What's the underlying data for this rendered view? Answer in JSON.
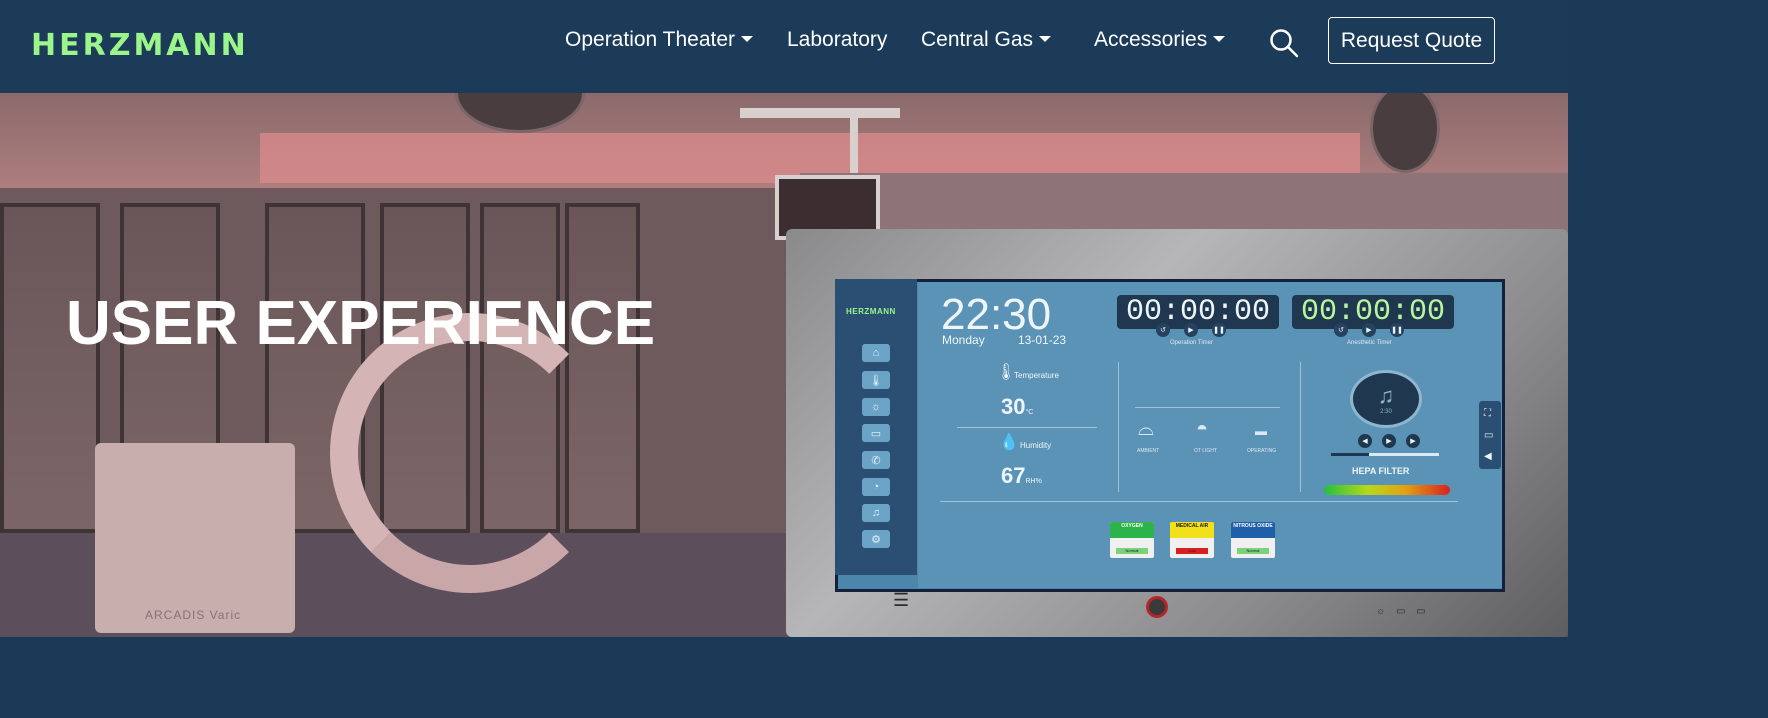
{
  "brand": {
    "logo_text": "HERZMANN"
  },
  "nav": {
    "items": [
      {
        "label": "Operation Theater",
        "has_dropdown": true
      },
      {
        "label": "Laboratory",
        "has_dropdown": false
      },
      {
        "label": "Central Gas",
        "has_dropdown": true
      },
      {
        "label": "Accessories",
        "has_dropdown": true
      }
    ],
    "search_icon": "search-icon",
    "quote_label": "Request Quote"
  },
  "hero": {
    "title": "USER EXPERIENCE",
    "machine_label": "ARCADIS Varic"
  },
  "display": {
    "logo_text": "HERZMANN",
    "clock_time": "22:30",
    "day": "Monday",
    "date": "13-01-23",
    "operation_timer": {
      "value": "00:00:00",
      "label": "Operation Timer"
    },
    "anesthetic_timer": {
      "value": "00:00:00",
      "label": "Anesthetic Timer"
    },
    "temperature": {
      "label": "Temperature",
      "value": "30",
      "unit": "°C"
    },
    "humidity": {
      "label": "Humidity",
      "value": "67",
      "unit": "RH%"
    },
    "lights": [
      {
        "label": "AMBIENT",
        "icon": "ceiling-lamp-icon"
      },
      {
        "label": "OT LIGHT",
        "icon": "surgical-light-icon"
      },
      {
        "label": "OPERATING",
        "icon": "operating-light-icon"
      }
    ],
    "music_time": "2:30",
    "music_progress": 0.35,
    "hepa_label": "HEPA FILTER",
    "gases": [
      {
        "name": "OXYGEN",
        "status": "Normal",
        "head_color": "#2cb34a",
        "status_color": "#7bd27a"
      },
      {
        "name": "MEDICAL AIR",
        "status": "Low",
        "head_color": "#f2e11a",
        "status_color": "#d8211e"
      },
      {
        "name": "NITROUS OXIDE",
        "status": "Normal",
        "head_color": "#1f5fa8",
        "status_color": "#7bd27a"
      }
    ],
    "sidebar_icons": [
      "home-icon",
      "thermometer-icon",
      "light-icon",
      "folder-icon",
      "phone-icon",
      "gauge-icon",
      "music-icon",
      "settings-icon"
    ]
  },
  "colors": {
    "navbar_bg": "#1b3b58",
    "logo_green": "#9cf58a",
    "screen_blue": "#5b93b6"
  }
}
